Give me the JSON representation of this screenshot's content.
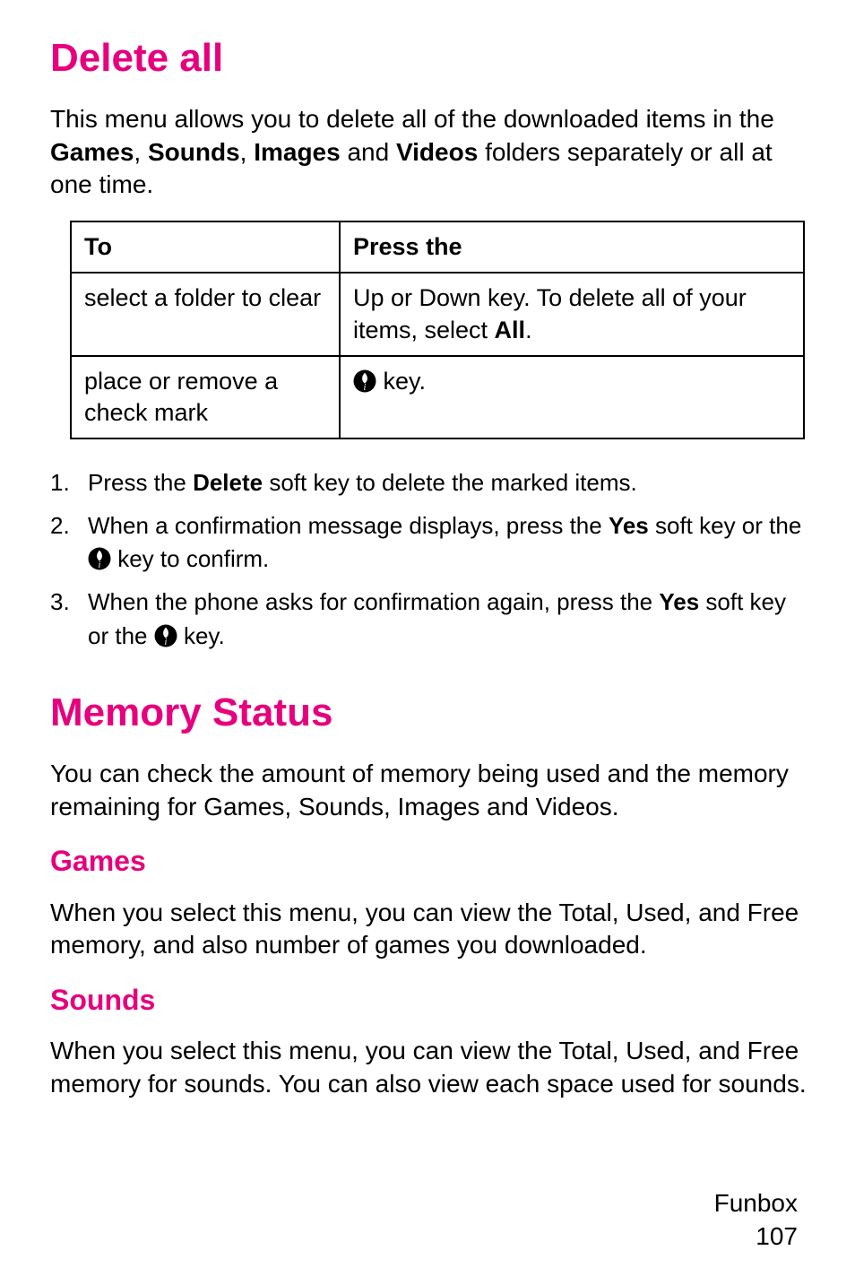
{
  "section1": {
    "heading": "Delete all",
    "intro_parts": [
      "This menu allows you to delete all of the downloaded items in the ",
      "Games",
      ", ",
      "Sounds",
      ", ",
      "Images",
      " and ",
      "Videos",
      " folders separately or all at one time."
    ],
    "table": {
      "head": {
        "c1": "To",
        "c2": "Press the"
      },
      "rows": [
        {
          "c1": "select a folder to clear",
          "c2_parts": [
            "Up or Down key. To delete all of your items, select ",
            "All",
            "."
          ]
        },
        {
          "c1": "place or remove a check mark",
          "c2_parts": [
            "",
            " key."
          ],
          "icon": "i-key"
        }
      ]
    },
    "steps": [
      {
        "parts": [
          "Press the ",
          "Delete",
          " soft key to delete the marked items."
        ]
      },
      {
        "parts": [
          "When a confirmation message displays, press the ",
          "Yes",
          " soft key or the ",
          " key to confirm."
        ],
        "icon_after_index": 3
      },
      {
        "parts": [
          "When the phone asks for confirmation again, press the ",
          "Yes",
          " soft key or the ",
          " key."
        ],
        "icon_after_index": 3
      }
    ]
  },
  "section2": {
    "heading": "Memory Status",
    "intro": "You can check the amount of memory being used and the memory remaining for Games, Sounds, Images and Videos.",
    "sub1": {
      "heading": "Games",
      "text": "When you select this menu, you can view the Total, Used, and Free memory, and also number of games you downloaded."
    },
    "sub2": {
      "heading": "Sounds",
      "text": "When you select this menu, you can view the Total, Used, and Free memory for sounds. You can also view each space used for sounds."
    }
  },
  "footer": {
    "label": "Funbox",
    "page": "107"
  }
}
